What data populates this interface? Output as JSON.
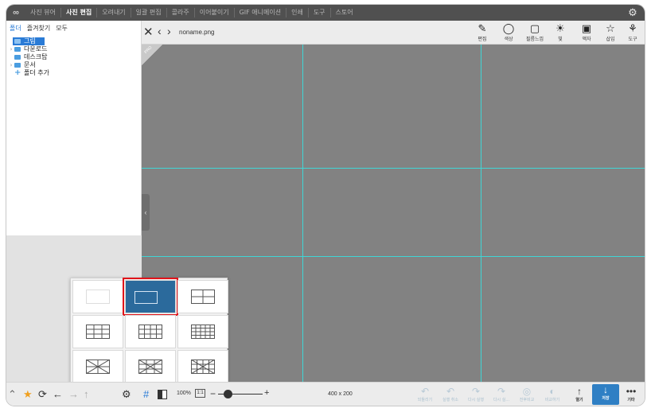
{
  "menubar": {
    "logo": "∞",
    "items": [
      "사진 뷰어",
      "사진 편집",
      "오려내기",
      "일괄 편집",
      "콜라주",
      "이어붙이기",
      "GIF 애니메이션",
      "인쇄",
      "도구",
      "스토어"
    ],
    "active_index": 1
  },
  "sidebar": {
    "tabs": [
      "폴더",
      "즐겨찾기",
      "모두"
    ],
    "tree": [
      {
        "label": "그림",
        "selected": true
      },
      {
        "label": "다운로드",
        "arrow": "›"
      },
      {
        "label": "데스크탑"
      },
      {
        "label": "문서",
        "arrow": "›"
      },
      {
        "label": "폴더 추가",
        "add": true
      }
    ]
  },
  "toolbar": {
    "close_icon": "✕",
    "prev_icon": "‹",
    "next_icon": "›",
    "filename": "noname.png",
    "tools": [
      {
        "icon": "✎",
        "label": "편집"
      },
      {
        "icon": "◯",
        "label": "색상"
      },
      {
        "icon": "▢",
        "label": "필름느낌"
      },
      {
        "icon": "☀",
        "label": "빛"
      },
      {
        "icon": "▣",
        "label": "액자"
      },
      {
        "icon": "☆",
        "label": "삽입"
      },
      {
        "icon": "⚘",
        "label": "도구"
      }
    ]
  },
  "canvas": {
    "corner_label": "PRO",
    "guide_color": "#3fd6d6",
    "background": "#828282"
  },
  "collapse_tab": "‹",
  "grid_popup": {
    "options": [
      "none",
      "single-box",
      "2x2",
      "3x3",
      "4x3",
      "4x4",
      "2x2-diagonal",
      "3x3-diagonal",
      "4x4-diagonal"
    ],
    "selected_index": 1,
    "selected_color": "#2b6a9c",
    "highlight_color": "#e0141a"
  },
  "bottombar": {
    "zoom": "100%",
    "fit": "1:1",
    "minus": "−",
    "plus": "+",
    "image_size": "400 x 200",
    "actions": [
      {
        "icon": "↶",
        "label": "되돌리기",
        "enabled": false
      },
      {
        "icon": "↶",
        "label": "실행 취소",
        "enabled": false
      },
      {
        "icon": "↷",
        "label": "다시 실행",
        "enabled": false
      },
      {
        "icon": "↷",
        "label": "다시 실...",
        "enabled": false
      },
      {
        "icon": "◎",
        "label": "전후비교",
        "enabled": false
      },
      {
        "icon": "◐",
        "label": "비교하기",
        "enabled": false
      },
      {
        "icon": "↑",
        "label": "열기",
        "enabled": true
      },
      {
        "icon": "↓",
        "label": "저장",
        "enabled": true
      },
      {
        "icon": "•••",
        "label": "기타",
        "enabled": true
      }
    ]
  }
}
